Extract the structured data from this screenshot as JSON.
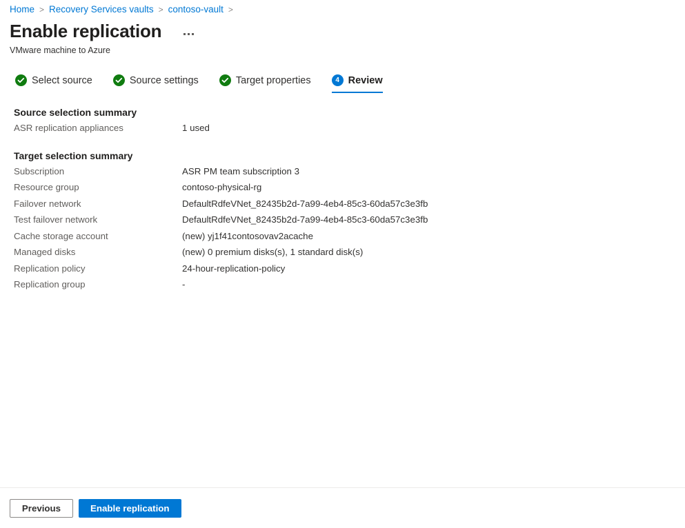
{
  "breadcrumb": {
    "items": [
      {
        "label": "Home"
      },
      {
        "label": "Recovery Services vaults"
      },
      {
        "label": "contoso-vault"
      }
    ],
    "separator": ">"
  },
  "header": {
    "title": "Enable replication",
    "subtitle": "VMware machine to Azure",
    "more_options_label": "..."
  },
  "tabs": [
    {
      "label": "Select source",
      "state": "done",
      "badge": ""
    },
    {
      "label": "Source settings",
      "state": "done",
      "badge": ""
    },
    {
      "label": "Target properties",
      "state": "done",
      "badge": ""
    },
    {
      "label": "Review",
      "state": "current",
      "badge": "4"
    }
  ],
  "sections": [
    {
      "heading": "Source selection summary",
      "rows": [
        {
          "key": "ASR replication appliances",
          "value": "1 used"
        }
      ]
    },
    {
      "heading": "Target selection summary",
      "rows": [
        {
          "key": "Subscription",
          "value": "ASR PM team subscription 3"
        },
        {
          "key": "Resource group",
          "value": "contoso-physical-rg"
        },
        {
          "key": "Failover network",
          "value": "DefaultRdfeVNet_82435b2d-7a99-4eb4-85c3-60da57c3e3fb"
        },
        {
          "key": "Test failover network",
          "value": "DefaultRdfeVNet_82435b2d-7a99-4eb4-85c3-60da57c3e3fb"
        },
        {
          "key": "Cache storage account",
          "value": "(new) yj1f41contosovav2acache"
        },
        {
          "key": "Managed disks",
          "value": "(new) 0 premium disks(s), 1 standard disk(s)"
        },
        {
          "key": "Replication policy",
          "value": "24-hour-replication-policy"
        },
        {
          "key": "Replication group",
          "value": "-"
        }
      ]
    }
  ],
  "footer": {
    "previous_label": "Previous",
    "submit_label": "Enable replication"
  },
  "colors": {
    "accent": "#0078d4",
    "success": "#107c10",
    "label_text": "#605e5c",
    "value_text": "#323130",
    "divider": "#edebe9"
  }
}
